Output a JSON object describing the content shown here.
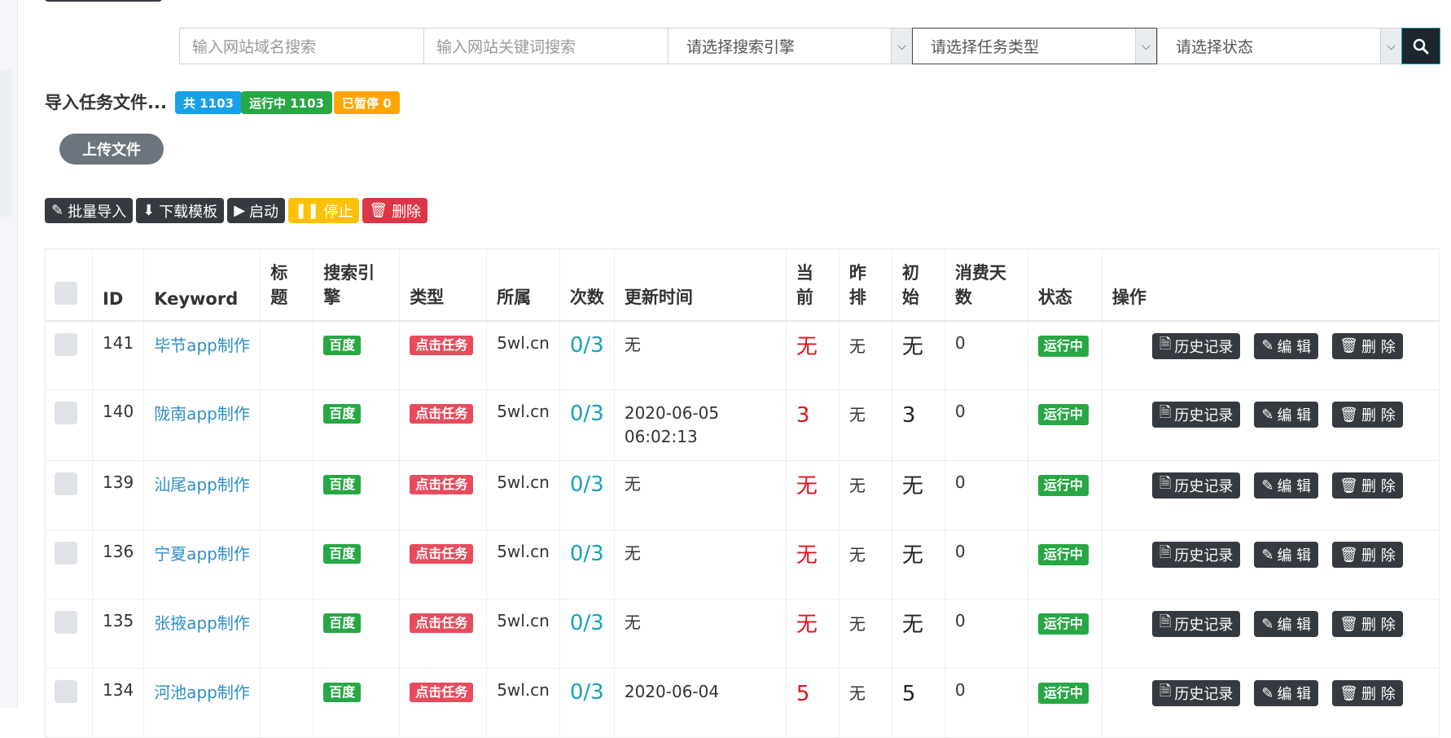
{
  "filters": {
    "domain_placeholder": "输入网站域名搜索",
    "keyword_placeholder": "输入网站关键词搜索",
    "engine_select": "请选择搜索引擎",
    "type_select": "请选择任务类型",
    "status_select": "请选择状态"
  },
  "import": {
    "title": "导入任务文件...",
    "badges": {
      "total": "共 1103",
      "running": "运行中 1103",
      "paused": "已暂停 0"
    },
    "upload_label": "上传文件"
  },
  "toolbar": {
    "batch_import": "批量导入",
    "download_template": "下载模板",
    "start": "启动",
    "stop": "停止",
    "delete": "删除"
  },
  "table": {
    "headers": [
      "ID",
      "Keyword",
      "标题",
      "搜索引擎",
      "类型",
      "所属",
      "次数",
      "更新时间",
      "当前",
      "昨排",
      "初始",
      "消费天数",
      "状态",
      "操作"
    ],
    "rows": [
      {
        "id": "141",
        "keyword": "毕节app制作",
        "title": "",
        "engine": "百度",
        "type": "点击任务",
        "domain": "5wl.cn",
        "count": "0/3",
        "updated": "无",
        "current": "无",
        "yesterday": "无",
        "initial": "无",
        "days": "0",
        "status": "运行中"
      },
      {
        "id": "140",
        "keyword": "陇南app制作",
        "title": "",
        "engine": "百度",
        "type": "点击任务",
        "domain": "5wl.cn",
        "count": "0/3",
        "updated": "2020-06-05 06:02:13",
        "current": "3",
        "yesterday": "无",
        "initial": "3",
        "days": "0",
        "status": "运行中"
      },
      {
        "id": "139",
        "keyword": "汕尾app制作",
        "title": "",
        "engine": "百度",
        "type": "点击任务",
        "domain": "5wl.cn",
        "count": "0/3",
        "updated": "无",
        "current": "无",
        "yesterday": "无",
        "initial": "无",
        "days": "0",
        "status": "运行中"
      },
      {
        "id": "136",
        "keyword": "宁夏app制作",
        "title": "",
        "engine": "百度",
        "type": "点击任务",
        "domain": "5wl.cn",
        "count": "0/3",
        "updated": "无",
        "current": "无",
        "yesterday": "无",
        "initial": "无",
        "days": "0",
        "status": "运行中"
      },
      {
        "id": "135",
        "keyword": "张掖app制作",
        "title": "",
        "engine": "百度",
        "type": "点击任务",
        "domain": "5wl.cn",
        "count": "0/3",
        "updated": "无",
        "current": "无",
        "yesterday": "无",
        "initial": "无",
        "days": "0",
        "status": "运行中"
      },
      {
        "id": "134",
        "keyword": "河池app制作",
        "title": "",
        "engine": "百度",
        "type": "点击任务",
        "domain": "5wl.cn",
        "count": "0/3",
        "updated": "2020-06-04",
        "current": "5",
        "yesterday": "无",
        "initial": "5",
        "days": "0",
        "status": "运行中"
      }
    ],
    "actions": {
      "history": "历史记录",
      "edit": "编 辑",
      "delete": "删 除"
    }
  },
  "colors": {
    "dark": "#343a40",
    "green": "#28a745",
    "red": "#e74c5c",
    "teal": "#17a2b8",
    "yellow": "#ffc107",
    "danger": "#dc3545"
  }
}
